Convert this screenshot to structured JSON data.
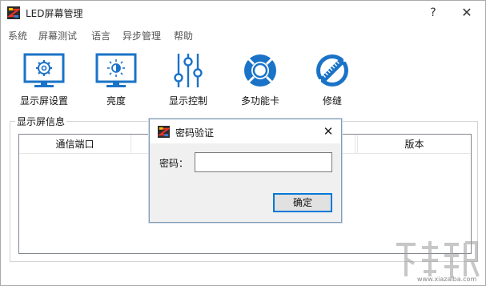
{
  "window": {
    "title": "LED屏幕管理",
    "help_glyph": "?",
    "close_glyph": "✕"
  },
  "menu": {
    "items": [
      "系统",
      "屏幕测试",
      "语言",
      "异步管理",
      "帮助"
    ]
  },
  "toolbar": {
    "tools": [
      {
        "label": "显示屏设置",
        "icon": "monitor-settings-icon"
      },
      {
        "label": "亮度",
        "icon": "monitor-brightness-icon"
      },
      {
        "label": "显示控制",
        "icon": "sliders-icon"
      },
      {
        "label": "多功能卡",
        "icon": "lifebuoy-icon"
      },
      {
        "label": "修缝",
        "icon": "seam-fix-icon"
      }
    ],
    "accent_color": "#1a73c7"
  },
  "screen_info": {
    "group_label": "显示屏信息",
    "columns": [
      "通信端口",
      "",
      "",
      "",
      "版本"
    ]
  },
  "dialog": {
    "title": "密码验证",
    "close_glyph": "✕",
    "password_label": "密码：",
    "password_value": "",
    "ok_label": "确定"
  },
  "watermark": {
    "url": "www.xiazaiba.com"
  }
}
